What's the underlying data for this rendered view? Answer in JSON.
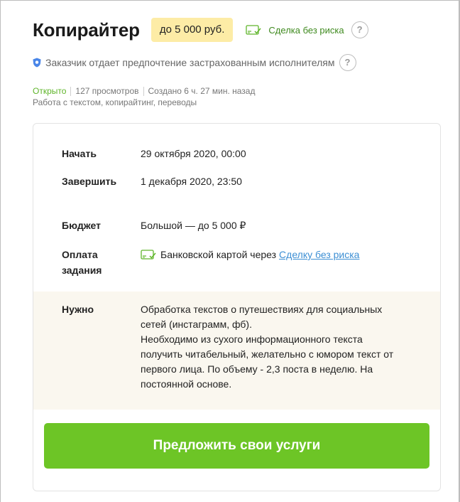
{
  "header": {
    "title": "Копирайтер",
    "price": "до 5 000 руб.",
    "safe_deal": "Сделка без риска",
    "help_mark": "?"
  },
  "preference": {
    "text": "Заказчик отдает предпочтение застрахованным исполнителям",
    "help_mark": "?"
  },
  "meta": {
    "status": "Открыто",
    "views": "127 просмотров",
    "created": "Создано 6 ч. 27 мин. назад",
    "categories": "Работа с текстом, копирайтинг, переводы"
  },
  "details": {
    "start_label": "Начать",
    "start_value": "29 октября 2020, 00:00",
    "end_label": "Завершить",
    "end_value": "1 декабря 2020, 23:50",
    "budget_label": "Бюджет",
    "budget_value": "Большой — до 5 000 ₽",
    "payment_label_line1": "Оплата",
    "payment_label_line2": "задания",
    "payment_text": "Банковской картой через",
    "payment_link": "Сделку без риска",
    "need_label": "Нужно",
    "need_lines": [
      "Обработка текстов о путешествиях для социальных",
      "сетей (инстаграмм, фб).",
      "Необходимо из сухого информационного текста",
      "получить читабельный, желательно с юмором текст от",
      "первого лица. По объему - 2,3 поста в неделю. На",
      "постоянной основе."
    ]
  },
  "cta": {
    "label": "Предложить свои услуги"
  },
  "colors": {
    "accent_green": "#6dc526",
    "status_green": "#5fb52a",
    "link_blue": "#3d8fd4",
    "price_badge_bg": "#fdeca6",
    "need_bg": "#faf7ef"
  }
}
